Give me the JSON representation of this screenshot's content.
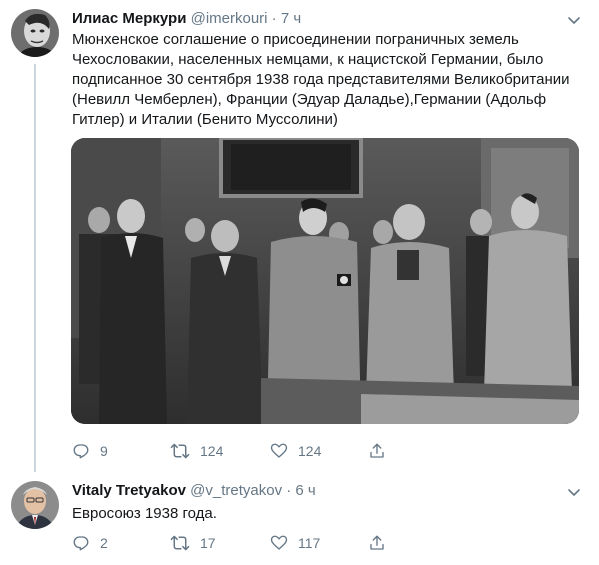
{
  "tweets": [
    {
      "author_name": "Илиас Меркури",
      "handle": "@imerkouri",
      "time": "7 ч",
      "text": "Мюнхенское соглашение о присоединении пограничных земель Чехословакии, населенных немцами, к нацистской Германии, было подписанное 30 сентября 1938 года представителями Великобритании (Невилл Чемберлен), Франции (Эдуар Даладье),Германии (Адольф Гитлер) и Италии (Бенито Муссолини)",
      "photo_alt": "Archival black-and-white photograph of four leaders with officials standing in a room",
      "replies": "9",
      "retweets": "124",
      "likes": "124"
    },
    {
      "author_name": "Vitaly Tretyakov",
      "handle": "@v_tretyakov",
      "time": "6 ч",
      "text": "Евросоюз 1938 года.",
      "replies": "2",
      "retweets": "17",
      "likes": "117"
    }
  ],
  "separator": "·",
  "icons": {
    "reply": "speech-bubble-outline",
    "retweet": "two-arrows-loop",
    "like": "heart-outline",
    "share": "upload-arrow",
    "menu": "chevron-down"
  },
  "colors": {
    "text": "#14171a",
    "secondary": "#657786",
    "thread_line": "#ccd6dd"
  }
}
